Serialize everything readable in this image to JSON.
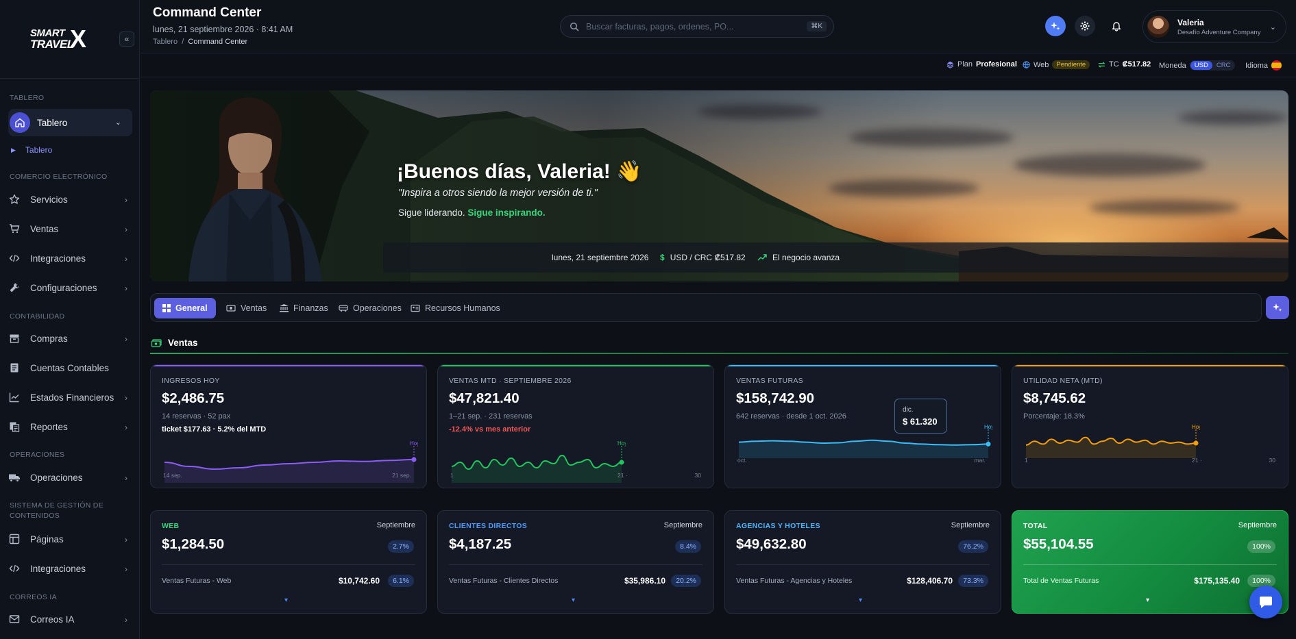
{
  "sidebar": {
    "logo_line1": "SMART",
    "logo_line2": "TRAVEL",
    "logo_x": "X",
    "collapse_icon": "«",
    "sections": {
      "tablero": "TABLERO",
      "comercio": "COMERCIO ELECTRÓNICO",
      "contabilidad": "CONTABILIDAD",
      "operaciones": "OPERACIONES",
      "cms": "SISTEMA DE GESTIÓN DE CONTENIDOS",
      "correos": "CORREOS IA"
    },
    "active_item": "Tablero",
    "sub_item": "Tablero",
    "items": {
      "servicios": "Servicios",
      "ventas": "Ventas",
      "integraciones": "Integraciones",
      "configuraciones": "Configuraciones",
      "compras": "Compras",
      "cuentas": "Cuentas Contables",
      "estados": "Estados Financieros",
      "reportes": "Reportes",
      "operaciones": "Operaciones",
      "paginas": "Páginas",
      "integraciones2": "Integraciones",
      "correos": "Correos IA"
    }
  },
  "header": {
    "title": "Command Center",
    "datetime": "lunes, 21 septiembre 2026 · 8:41 AM",
    "breadcrumb_root": "Tablero",
    "breadcrumb_sep": "/",
    "breadcrumb_current": "Command Center",
    "search_placeholder": "Buscar facturas, pagos, ordenes, PO...",
    "search_kbd": "⌘K",
    "user_name": "Valeria",
    "user_company": "Desafío Adventure Company"
  },
  "statusbar": {
    "plan_label": "Plan",
    "plan_value": "Profesional",
    "web_label": "Web",
    "web_status": "Pendiente",
    "tc_label": "TC",
    "tc_value": "₡517.82",
    "moneda_label": "Moneda",
    "moneda_on": "USD",
    "moneda_off": "CRC",
    "idioma_label": "Idioma"
  },
  "hero": {
    "greeting": "¡Buenos días, Valeria! 👋",
    "quote": "\"Inspira a otros siendo la mejor versión de ti.\"",
    "sub_prefix": "Sigue liderando.",
    "sub_highlight": "Sigue inspirando.",
    "bar_date": "lunes, 21 septiembre 2026",
    "bar_rate": "USD / CRC ₡517.82",
    "bar_trend": "El negocio avanza"
  },
  "tabs": [
    "General",
    "Ventas",
    "Finanzas",
    "Operaciones",
    "Recursos Humanos"
  ],
  "section_title": "Ventas",
  "kpis": [
    {
      "title": "INGRESOS HOY",
      "value": "$2,486.75",
      "sub": "14 reservas · 52 pax",
      "sub2": "ticket $177.63 · 5.2% del MTD",
      "color": "#8b5cf6",
      "tick_start": "14 sep.",
      "tick_end": "21 sep.",
      "marker": "Hoy",
      "series": [
        0.55,
        0.4,
        0.3,
        0.35,
        0.45,
        0.5,
        0.55,
        0.6,
        0.58,
        0.62,
        0.65
      ]
    },
    {
      "title": "VENTAS MTD · SEPTIEMBRE 2026",
      "value": "$47,821.40",
      "sub": "1–21 sep. · 231 reservas",
      "red": "-12.4% vs mes anterior",
      "color": "#22c55e",
      "tick_start": "1",
      "tick_mid": "21 ·",
      "tick_end": "30",
      "marker": "Hoy",
      "series": [
        0.4,
        0.55,
        0.3,
        0.6,
        0.35,
        0.65,
        0.45,
        0.7,
        0.4,
        0.55,
        0.35,
        0.6,
        0.5,
        0.8,
        0.45,
        0.55,
        0.65,
        0.35,
        0.5,
        0.4,
        0.55
      ]
    },
    {
      "title": "VENTAS FUTURAS",
      "value": "$158,742.90",
      "sub": "642 reservas · desde 1 oct. 2026",
      "color": "#38bdf8",
      "tick_start": "oct.",
      "tick_end": "mar.",
      "marker": "Hoy",
      "tooltip_label": "dic.",
      "tooltip_value": "$ 61.320",
      "series": [
        0.55,
        0.6,
        0.62,
        0.6,
        0.55,
        0.5,
        0.52,
        0.6,
        0.65,
        0.6,
        0.5,
        0.45,
        0.42,
        0.4,
        0.42,
        0.45
      ]
    },
    {
      "title": "UTILIDAD NETA (MTD)",
      "value": "$8,745.62",
      "sub": "Porcentaje: 18.3%",
      "color": "#f59e0b",
      "tick_start": "1",
      "tick_mid": "21 ·",
      "tick_end": "30",
      "marker": "Hoy",
      "series": [
        0.4,
        0.6,
        0.45,
        0.7,
        0.5,
        0.65,
        0.55,
        0.8,
        0.45,
        0.6,
        0.75,
        0.5,
        0.7,
        0.55,
        0.65,
        0.45,
        0.6,
        0.5,
        0.55,
        0.45,
        0.5
      ]
    }
  ],
  "breakdown": [
    {
      "title": "WEB",
      "month": "Septiembre",
      "value": "$1,284.50",
      "pct": "2.7%",
      "label": "Ventas Futuras - Web",
      "amount": "$10,742.60",
      "pct2": "6.1%",
      "color": "#37d67a"
    },
    {
      "title": "CLIENTES DIRECTOS",
      "month": "Septiembre",
      "value": "$4,187.25",
      "pct": "8.4%",
      "label": "Ventas Futuras - Clientes Directos",
      "amount": "$35,986.10",
      "pct2": "20.2%",
      "color": "#4f9cff"
    },
    {
      "title": "AGENCIAS Y HOTELES",
      "month": "Septiembre",
      "value": "$49,632.80",
      "pct": "76.2%",
      "label": "Ventas Futuras - Agencias y Hoteles",
      "amount": "$128,406.70",
      "pct2": "73.3%",
      "color": "#4fb6ff"
    },
    {
      "title": "TOTAL",
      "month": "Septiembre",
      "value": "$55,104.55",
      "pct": "100%",
      "label": "Total de Ventas Futuras",
      "amount": "$175,135.40",
      "pct2": "100%",
      "color": "#ffffff"
    }
  ],
  "colors": {
    "accent": "#5b5fe0",
    "success": "#22c55e",
    "bg": "#0d1117"
  }
}
